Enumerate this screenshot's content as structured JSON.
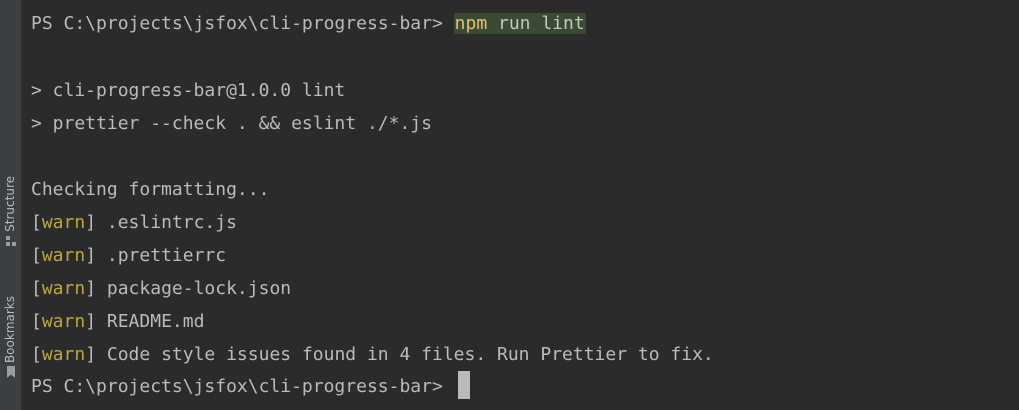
{
  "sidebar": {
    "structure_label": "Structure",
    "bookmarks_label": "Bookmarks"
  },
  "terminal": {
    "prompt_1": "PS C:\\projects\\jsfox\\cli-progress-bar> ",
    "command_keyword": "npm",
    "command_rest": " run lint",
    "script_line_1": "> cli-progress-bar@1.0.0 lint",
    "script_line_2": "> prettier --check . && eslint ./*.js",
    "checking": "Checking formatting...",
    "warnings": [
      {
        "open": "[",
        "tag": "warn",
        "close": "]",
        "text": " .eslintrc.js"
      },
      {
        "open": "[",
        "tag": "warn",
        "close": "]",
        "text": " .prettierrc"
      },
      {
        "open": "[",
        "tag": "warn",
        "close": "]",
        "text": " package-lock.json"
      },
      {
        "open": "[",
        "tag": "warn",
        "close": "]",
        "text": " README.md"
      },
      {
        "open": "[",
        "tag": "warn",
        "close": "]",
        "text": " Code style issues found in 4 files. Run Prettier to fix."
      }
    ],
    "prompt_2": "PS C:\\projects\\jsfox\\cli-progress-bar> "
  },
  "colors": {
    "background": "#2b2b2b",
    "text": "#bbbbbb",
    "warn": "#bba83d",
    "command_highlight_bg": "#3b4a35",
    "command_keyword": "#e8bf6a"
  },
  "icons": {
    "structure": "structure-icon",
    "bookmarks": "bookmark-icon"
  }
}
